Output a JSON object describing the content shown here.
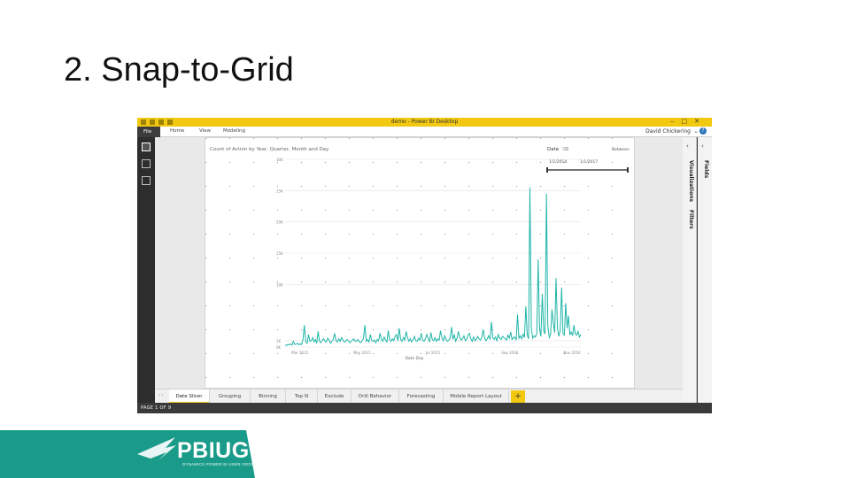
{
  "slide": {
    "title": "2. Snap-to-Grid"
  },
  "app": {
    "window_title": "demo - Power BI Desktop",
    "ribbon_tabs": [
      "File",
      "Home",
      "View",
      "Modeling"
    ],
    "user_name": "David Chickering",
    "help_label": "?",
    "status_text": "PAGE 1 OF 9"
  },
  "panes": {
    "visualizations_label": "Visualizations",
    "filters_label": "Filters",
    "fields_label": "Fields"
  },
  "page_tabs": [
    "Date Slicer",
    "Grouping",
    "Binning",
    "Top N",
    "Exclude",
    "Drill Behavior",
    "Forecasting",
    "Mobile Report Layout"
  ],
  "add_page_label": "+",
  "slicer": {
    "title": "Date",
    "mode": "Between",
    "start": "1/1/2014",
    "end": "1/1/2017"
  },
  "chart_data": {
    "type": "line",
    "title": "Count of Action by Year, Quarter, Month and Day",
    "xlabel": "Date Day",
    "ylabel": "",
    "y_ticks": [
      "0K",
      "1K",
      "10K",
      "15K",
      "20K",
      "25K",
      "30K"
    ],
    "ylim": [
      0,
      30000
    ],
    "x_ticks": [
      "Mar 2015",
      "May 2015",
      "Jul 2015",
      "Sep 2016",
      "Nov 2016"
    ],
    "line_color": "#1fb5a8",
    "series": [
      {
        "values": [
          300,
          250,
          400,
          350,
          500,
          300,
          900,
          400,
          450,
          600,
          350,
          500,
          400,
          1200,
          3500,
          800,
          600,
          2000,
          900,
          1000,
          1500,
          800,
          1200,
          600,
          2500,
          900,
          700,
          1100,
          1300,
          900,
          800,
          1400,
          1100,
          600,
          900,
          1200,
          2200,
          1000,
          800,
          1300,
          900,
          1500,
          1100,
          800,
          900,
          1200,
          1000,
          700,
          900,
          1100,
          1300,
          900,
          1000,
          1200,
          800,
          700,
          1000,
          1400,
          3500,
          900,
          1200,
          800,
          2000,
          1000,
          900,
          1100,
          700,
          1200,
          1000,
          2200,
          1300,
          900,
          1600,
          1100,
          800,
          2600,
          1200,
          900,
          1300,
          1000,
          1700,
          2000,
          1000,
          3000,
          1200,
          900,
          1500,
          1100,
          2500,
          1500,
          900,
          1300,
          800,
          1200,
          1700,
          1000,
          900,
          1400,
          1100,
          2200,
          1100,
          900,
          1300,
          2000,
          1400,
          800,
          2300,
          1200,
          1000,
          1500,
          900,
          1300,
          1100,
          2600,
          1400,
          1000,
          1800,
          1200,
          900,
          1100,
          1400,
          3200,
          1200,
          2000,
          900,
          1400,
          2500,
          1500,
          1100,
          1300,
          1800,
          1000,
          1200,
          1900,
          2200,
          1300,
          900,
          1600,
          1000,
          1200,
          1700,
          1300,
          1100,
          1500,
          2800,
          1400,
          1000,
          1300,
          1800,
          1200,
          4000,
          1500,
          1200,
          1600,
          1000,
          2000,
          1400,
          1200,
          1700,
          1500,
          1300,
          1100,
          1900,
          1400,
          2400,
          1200,
          1500,
          1600,
          1100,
          5200,
          1400,
          1800,
          1300,
          2100,
          1500,
          6500,
          2000,
          1300,
          25500,
          3000,
          1400,
          1800,
          1600,
          2200,
          14000,
          2800,
          1700,
          8500,
          2500,
          2100,
          24500,
          3500,
          1500,
          2000,
          6000,
          3800,
          2300,
          11000,
          3000,
          1700,
          2600,
          9500,
          2200,
          1900,
          7000,
          3000,
          5000,
          2000,
          2400,
          1800,
          3500,
          2100,
          1900,
          2500,
          1600,
          2000
        ]
      }
    ]
  }
}
